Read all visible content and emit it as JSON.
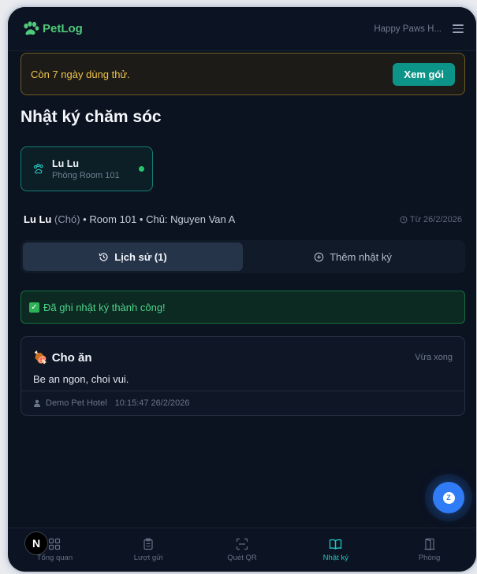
{
  "header": {
    "logo_text": "PetLog",
    "hotel_name": "Happy Paws H...",
    "brand_color": "#4fc97a"
  },
  "trial_banner": {
    "message": "Còn 7 ngày dùng thử.",
    "button_label": "Xem gói"
  },
  "page_title": "Nhật ký chăm sóc",
  "pet_card": {
    "name": "Lu Lu",
    "room": "Phòng Room 101",
    "status_color": "#27c46b"
  },
  "pet_info": {
    "name": "Lu Lu",
    "species": "(Chó)",
    "details": "• Room 101 • Chủ: Nguyen Van A",
    "since": "Từ 26/2/2026"
  },
  "tabs": [
    {
      "label": "Lịch sử (1)",
      "icon": "history-icon",
      "active": true
    },
    {
      "label": "Thêm nhật ký",
      "icon": "plus-circle-icon",
      "active": false
    }
  ],
  "success_message": "Đã ghi nhật ký thành công!",
  "entries": [
    {
      "emoji": "🍖",
      "title": "Cho ăn",
      "relative_time": "Vừa xong",
      "body": "Be an ngon, choi vui.",
      "author": "Demo Pet Hotel",
      "timestamp": "10:15:47 26/2/2026"
    }
  ],
  "chat_button": {
    "label": "Z"
  },
  "dev_badge": {
    "label": "N"
  },
  "bottom_nav": [
    {
      "label": "Tổng quan",
      "icon": "dashboard-grid-icon",
      "active": false
    },
    {
      "label": "Lượt gửi",
      "icon": "clipboard-icon",
      "active": false
    },
    {
      "label": "Quét QR",
      "icon": "scan-qr-icon",
      "active": false
    },
    {
      "label": "Nhật ký",
      "icon": "book-open-icon",
      "active": true
    },
    {
      "label": "Phòng",
      "icon": "door-icon",
      "active": false
    }
  ],
  "colors": {
    "accent_teal": "#0d9488",
    "active_nav": "#22c5c0",
    "warning_border": "#6e5a24",
    "success_text": "#4cd48a"
  }
}
